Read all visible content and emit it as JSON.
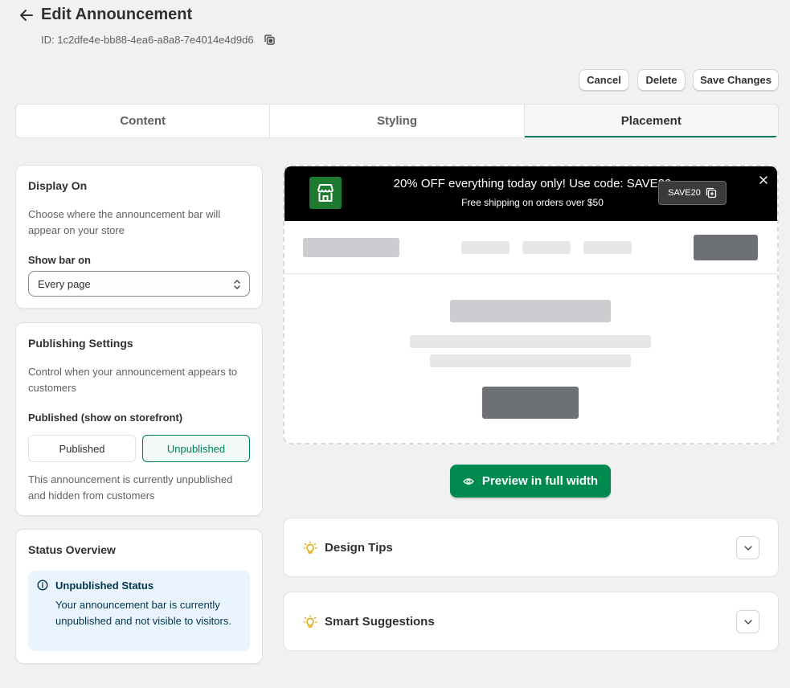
{
  "header": {
    "title": "Edit Announcement",
    "id_label": "ID: 1c2dfe4e-bb88-4ea6-a8a8-7e4014e4d9d6",
    "back_icon": "arrow-left-icon",
    "copy_icon": "copy-icon"
  },
  "actions": {
    "cancel": "Cancel",
    "delete": "Delete",
    "save": "Save Changes"
  },
  "tabs": [
    {
      "label": "Content",
      "active": false
    },
    {
      "label": "Styling",
      "active": false
    },
    {
      "label": "Placement",
      "active": true
    }
  ],
  "display_on": {
    "title": "Display On",
    "description": "Choose where the announcement bar will appear on your store",
    "field_label": "Show bar on",
    "selected": "Every page"
  },
  "publishing": {
    "title": "Publishing Settings",
    "description": "Control when your announcement appears to customers",
    "field_label": "Published (show on storefront)",
    "options": [
      "Published",
      "Unpublished"
    ],
    "selected": "Unpublished",
    "note": "This announcement is currently unpublished and hidden from customers"
  },
  "status": {
    "title": "Status Overview",
    "box_title": "Unpublished Status",
    "box_text": "Your announcement bar is currently unpublished and not visible to visitors."
  },
  "preview": {
    "main_text": "20% OFF everything today only! Use code: SAVE20",
    "sub_text": "Free shipping on orders over $50",
    "code": "SAVE20",
    "bar_color": "#000000",
    "logo_color": "#1e7a2e"
  },
  "full_width_button": "Preview in full width",
  "accordions": [
    {
      "title": "Design Tips",
      "icon": "lightbulb-icon"
    },
    {
      "title": "Smart Suggestions",
      "icon": "lightbulb-icon"
    }
  ],
  "colors": {
    "accent": "#008060",
    "primary_button": "#008a50",
    "info_bg": "#eaf4ff"
  }
}
